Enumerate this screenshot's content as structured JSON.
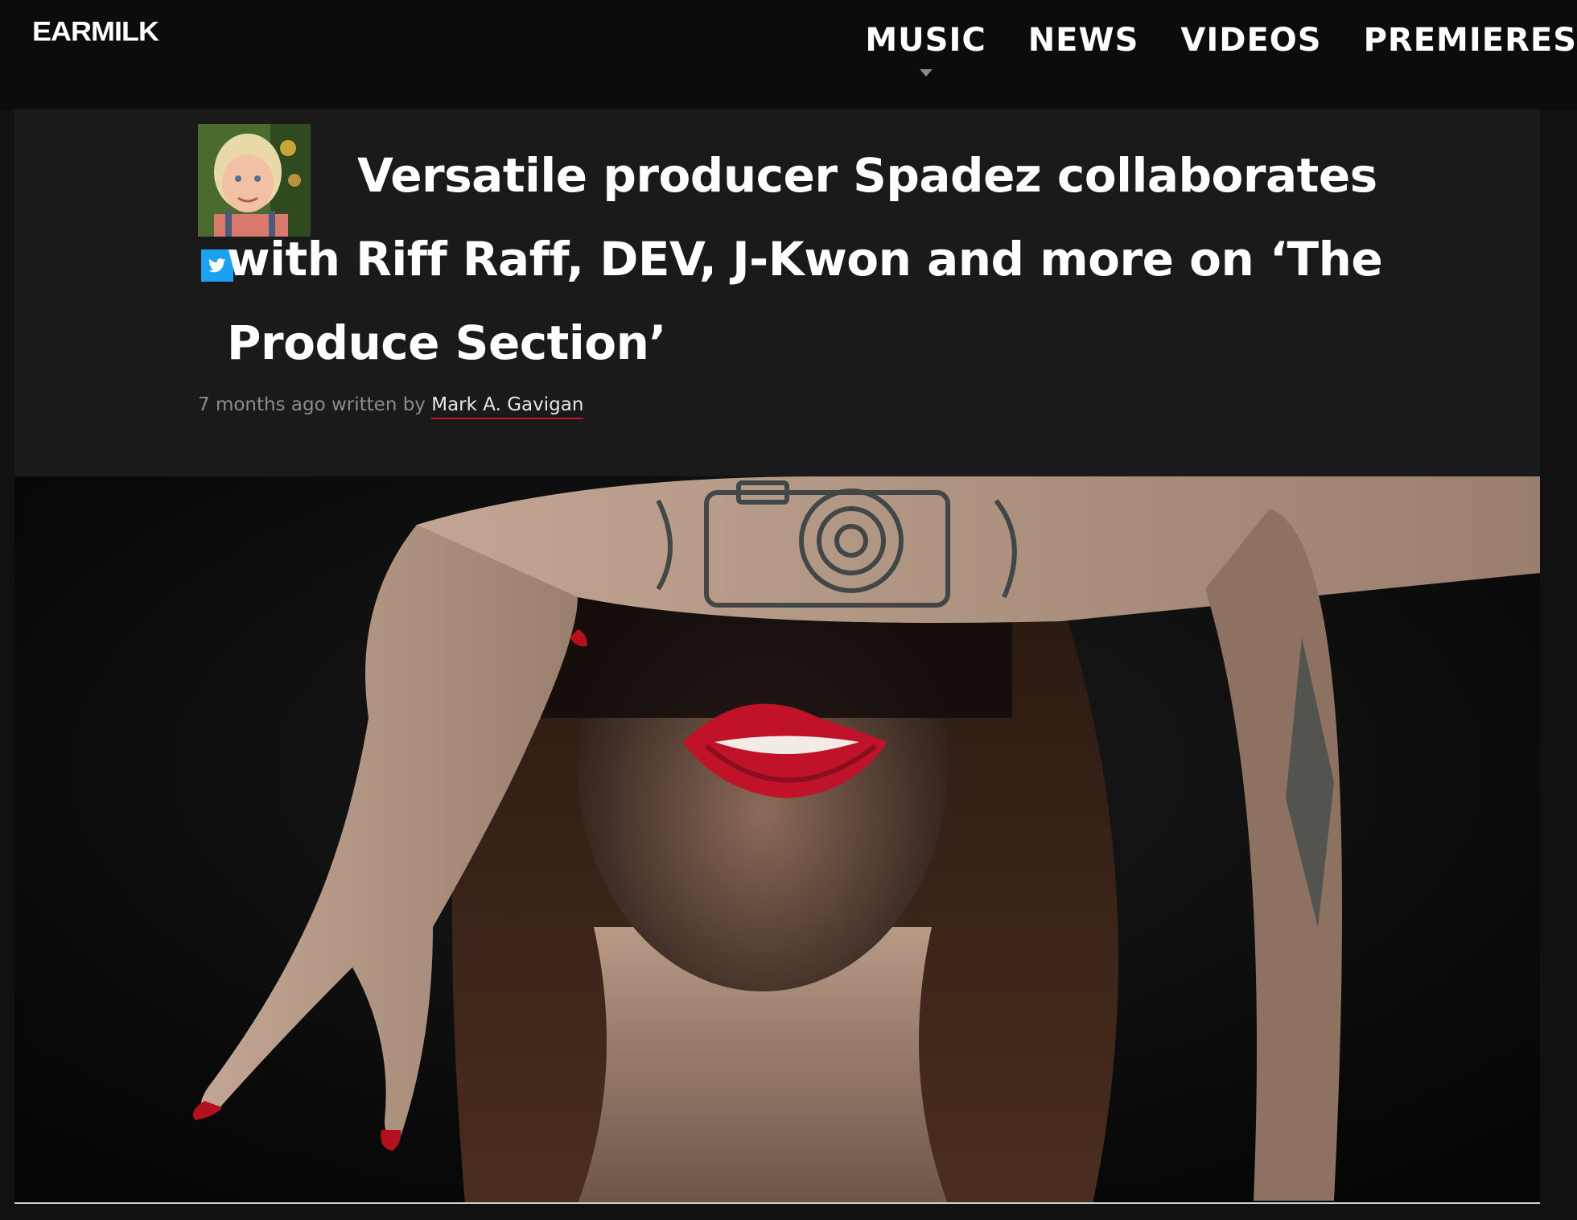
{
  "site": {
    "logo_text": "EARMILK"
  },
  "nav": {
    "items": [
      {
        "label": "MUSIC"
      },
      {
        "label": "NEWS"
      },
      {
        "label": "VIDEOS"
      },
      {
        "label": "PREMIERES"
      }
    ]
  },
  "article": {
    "title": "Versatile producer Spadez collaborates with Riff Raff, DEV, J-Kwon and more on ‘The Produce Section’",
    "time_ago": "7 months ago",
    "written_by": "written by",
    "author": "Mark A. Gavigan"
  },
  "colors": {
    "background": "#111111",
    "panel": "#1a1a1a",
    "twitter": "#1da1f2",
    "author_underline": "#c0182a"
  },
  "icons": {
    "twitter": "twitter-icon",
    "nav_caret": "chevron-down-icon"
  }
}
